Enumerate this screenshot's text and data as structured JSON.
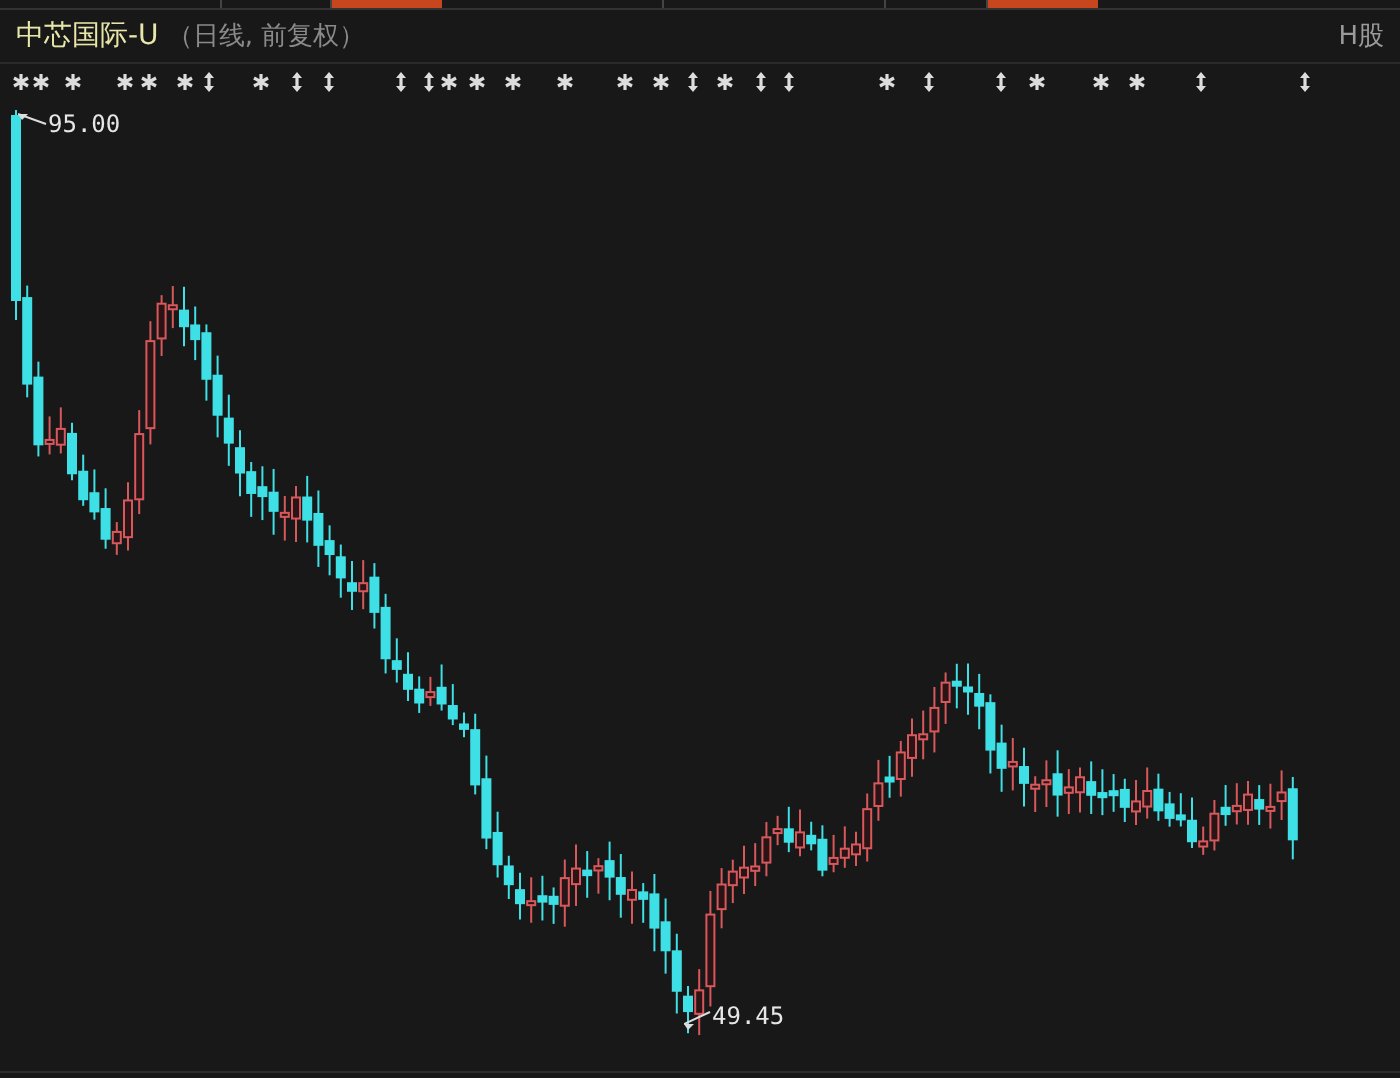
{
  "header": {
    "title": "中芯国际-U",
    "subtitle": "（日线, 前复权）",
    "market": "H股"
  },
  "chart": {
    "high_label": "95.00",
    "low_label": "49.45"
  }
}
